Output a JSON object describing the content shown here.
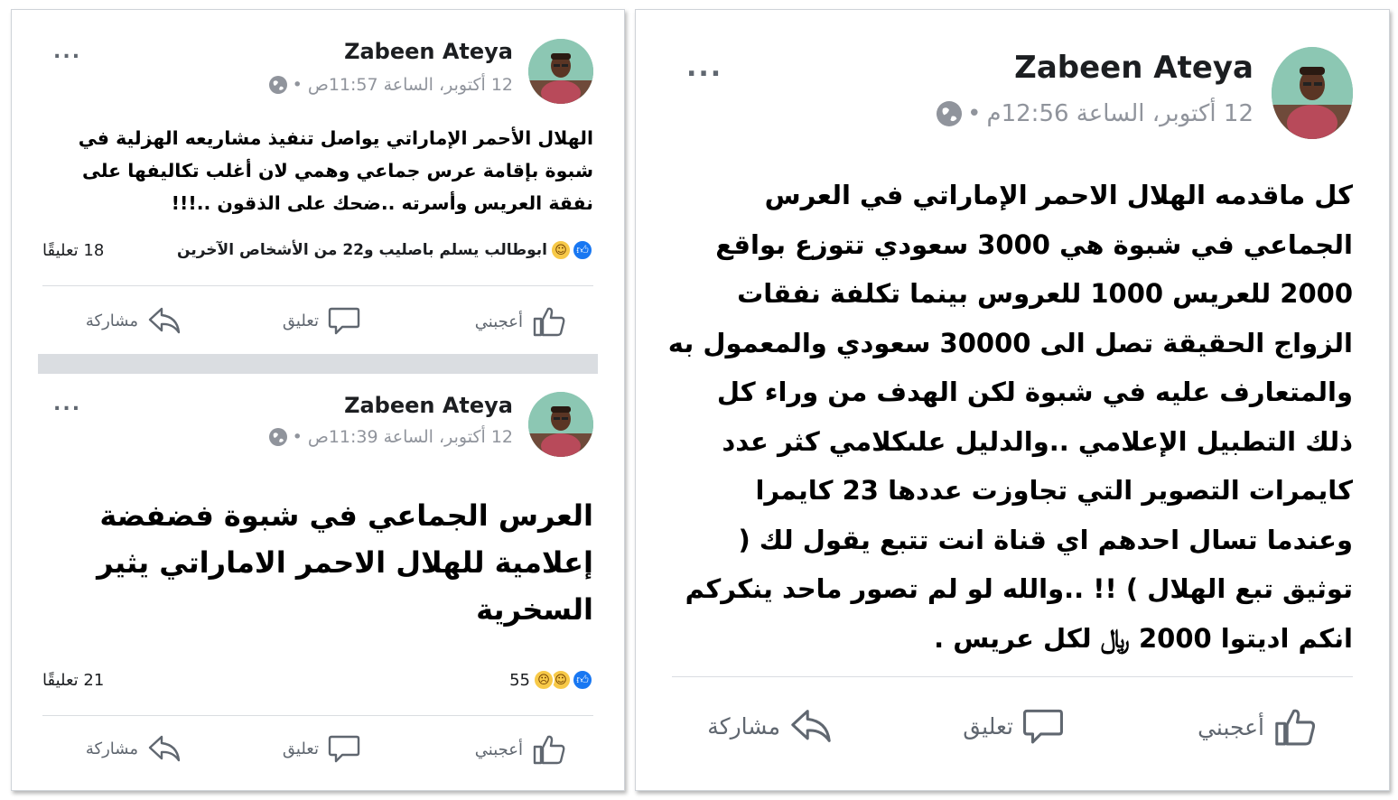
{
  "colors": {
    "meta_gray": "#90949c",
    "action_gray": "#606770",
    "like_blue": "#1877f2",
    "reaction_yellow": "#f7c948",
    "divider": "#dadde1"
  },
  "posts": [
    {
      "author": "Zabeen Ateya",
      "timestamp": "12 أكتوبر، الساعة 11:57ص",
      "privacy_icon": "globe-icon",
      "menu_icon": "more-dots-icon",
      "more_label": "...",
      "separator": "•",
      "body": "الهلال الأحمر الإماراتي يواصل تنفيذ مشاريعه الهزلية في شبوة بإقامة عرس جماعي وهمي لان أغلب تكاليفها على نفقة العريس وأسرته ..ضحك على الذقون ..!!!",
      "reactions": {
        "icons": [
          "like-icon",
          "haha-icon"
        ],
        "text": "ابوطالب يسلم باصليب و22 من الأشخاص الآخرين"
      },
      "comments": "18 تعليقًا",
      "actions": {
        "like": "أعجبني",
        "comment": "تعليق",
        "share": "مشاركة"
      }
    },
    {
      "author": "Zabeen Ateya",
      "timestamp": "12 أكتوبر، الساعة 11:39ص",
      "privacy_icon": "globe-icon",
      "menu_icon": "more-dots-icon",
      "more_label": "...",
      "separator": "•",
      "body": "العرس الجماعي في شبوة فضفضة إعلامية للهلال الاحمر الاماراتي يثير السخرية",
      "reactions": {
        "icons": [
          "like-icon",
          "haha-icon",
          "sad-icon"
        ],
        "text": "55"
      },
      "comments": "21 تعليقًا",
      "actions": {
        "like": "أعجبني",
        "comment": "تعليق",
        "share": "مشاركة"
      }
    },
    {
      "author": "Zabeen Ateya",
      "timestamp": "12 أكتوبر، الساعة 12:56م",
      "privacy_icon": "globe-icon",
      "menu_icon": "more-dots-icon",
      "more_label": "...",
      "separator": "•",
      "body": "كل ماقدمه الهلال الاحمر الإماراتي في العرس الجماعي في شبوة هي 3000 سعودي تتوزع بواقع 2000 للعريس 1000 للعروس بينما تكلفة نفقات الزواج الحقيقة تصل الى 30000 سعودي والمعمول به والمتعارف عليه في شبوة لكن الهدف من وراء كل ذلك التطبيل الإعلامي ..والدليل علىكلامي كثر عدد كايمرات التصوير التي تجاوزت عددها 23 كايمرا وعندما تسال احدهم اي قناة انت تتبع يقول لك ( توثيق تبع الهلال ) !! ..والله لو لم تصور ماحد ينكركم انكم اديتوا 2000 ﷼ لكل عريس .",
      "actions": {
        "like": "أعجبني",
        "comment": "تعليق",
        "share": "مشاركة"
      }
    }
  ]
}
